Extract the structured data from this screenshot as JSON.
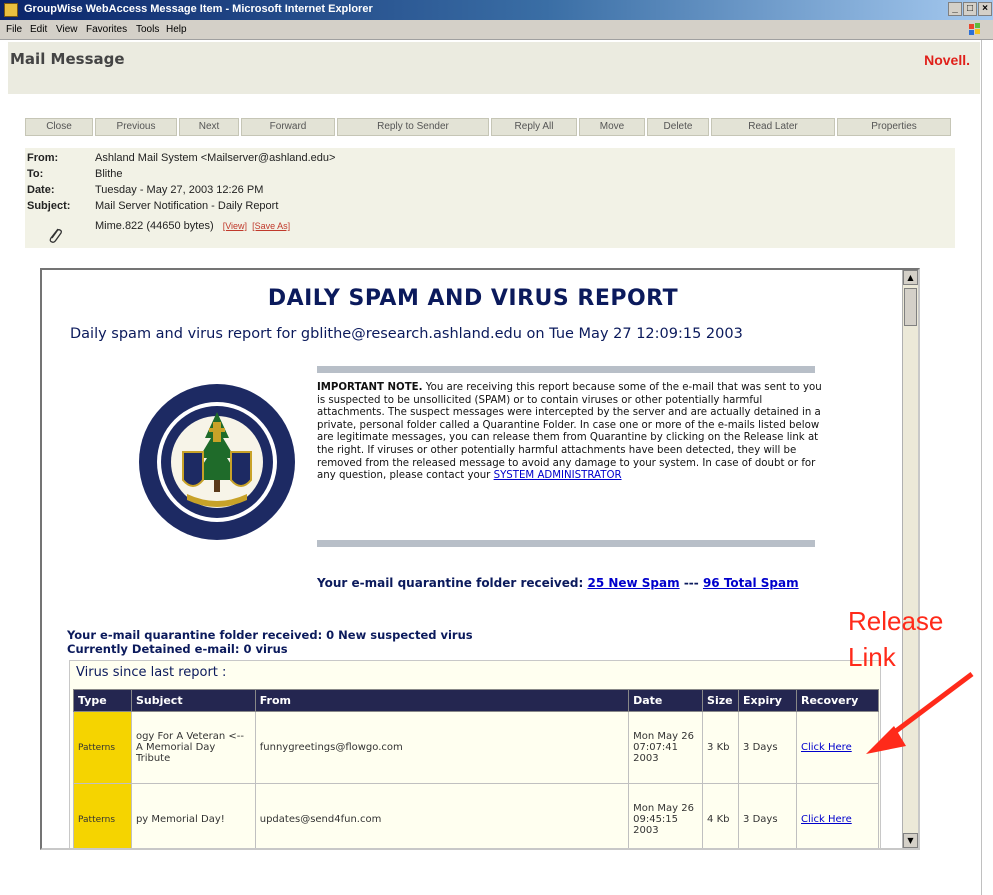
{
  "window": {
    "title": "GroupWise WebAccess Message Item - Microsoft Internet Explorer",
    "controls": [
      "_",
      "□",
      "×"
    ]
  },
  "menu": [
    "File",
    "Edit",
    "View",
    "Favorites",
    "Tools",
    "Help"
  ],
  "header": {
    "title": "Mail Message",
    "brand": "Novell."
  },
  "toolbar": [
    "Close",
    "Previous",
    "Next",
    "Forward",
    "Reply to Sender",
    "Reply All",
    "Move",
    "Delete",
    "Read Later",
    "Properties"
  ],
  "message": {
    "from_label": "From:",
    "from": "Ashland Mail System <Mailserver@ashland.edu>",
    "to_label": "To:",
    "to": "Blithe",
    "date_label": "Date:",
    "date": "Tuesday - May 27, 2003 12:26 PM",
    "subject_label": "Subject:",
    "subject": "Mail Server Notification - Daily Report",
    "attachment": "Mime.822 (44650 bytes)",
    "view_link": "[View]",
    "saveas_link": "[Save As]"
  },
  "report": {
    "title": "DAILY SPAM AND VIRUS REPORT",
    "subtitle": "Daily spam and virus report for gblithe@research.ashland.edu on Tue May 27 12:09:15 2003",
    "note_bold": "IMPORTANT NOTE.",
    "note_body": "You are receiving this report because some of the e-mail that was sent to you is suspected to be unsollicited (SPAM) or to contain viruses or other potentially harmful attachments. The suspect messages were intercepted by the server and are actually detained in a private, personal folder called a Quarantine Folder. In case one or more of the e-mails listed below are legitimate messages, you can release them from Quarantine by clicking on the Release link at the right. If viruses or other potentially harmful attachments have been detected, they will be removed from the released message to avoid any damage to your system. In case of doubt or for any question, please contact your",
    "note_link": "SYSTEM ADMINISTRATOR",
    "quarantine_prefix": "Your e-mail quarantine folder received:",
    "new_spam_link": "25 New Spam",
    "separator": "---",
    "total_spam_link": "96 Total Spam",
    "virus_line1": "Your e-mail quarantine folder received: 0 New suspected virus",
    "virus_line2": "Currently Detained e-mail: 0 virus",
    "virus_box_title": "Virus since last report :",
    "table": {
      "columns": [
        "Type",
        "Subject",
        "From",
        "Date",
        "Size",
        "Expiry",
        "Recovery"
      ],
      "rows": [
        {
          "type": "Patterns",
          "subject": "ogy For A Veteran <-- A Memorial Day Tribute",
          "from": "funnygreetings@flowgo.com",
          "date": "Mon May 26 07:07:41 2003",
          "size": "3 Kb",
          "expiry": "3 Days",
          "recovery": "Click Here"
        },
        {
          "type": "Patterns",
          "subject": "py Memorial Day!",
          "from": "updates@send4fun.com",
          "date": "Mon May 26 09:45:15 2003",
          "size": "4 Kb",
          "expiry": "3 Days",
          "recovery": "Click Here"
        }
      ]
    }
  },
  "annotation": {
    "line1": "Release",
    "line2": "Link"
  },
  "colors": {
    "navy": "#0b1a5c",
    "header_bg": "#ebebe0",
    "table_header": "#242650",
    "type_cell": "#f5d400",
    "annotation": "#ff2a1a",
    "novell_red": "#e0201a"
  }
}
